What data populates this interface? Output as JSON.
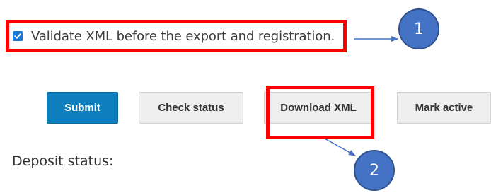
{
  "validation": {
    "checked": true,
    "label": "Validate XML before the export and registration."
  },
  "actions": {
    "submit_label": "Submit",
    "check_status_label": "Check status",
    "download_xml_label": "Download XML",
    "mark_active_label": "Mark active"
  },
  "deposit": {
    "status_label": "Deposit status:"
  },
  "callouts": {
    "marker_1": "1",
    "marker_2": "2"
  },
  "colors": {
    "primary_button": "#0e7ebd",
    "checkbox": "#1976d2",
    "highlight": "#ff0000",
    "marker_fill": "#4472c4",
    "marker_border": "#2f528f",
    "arrow": "#4472c4"
  }
}
